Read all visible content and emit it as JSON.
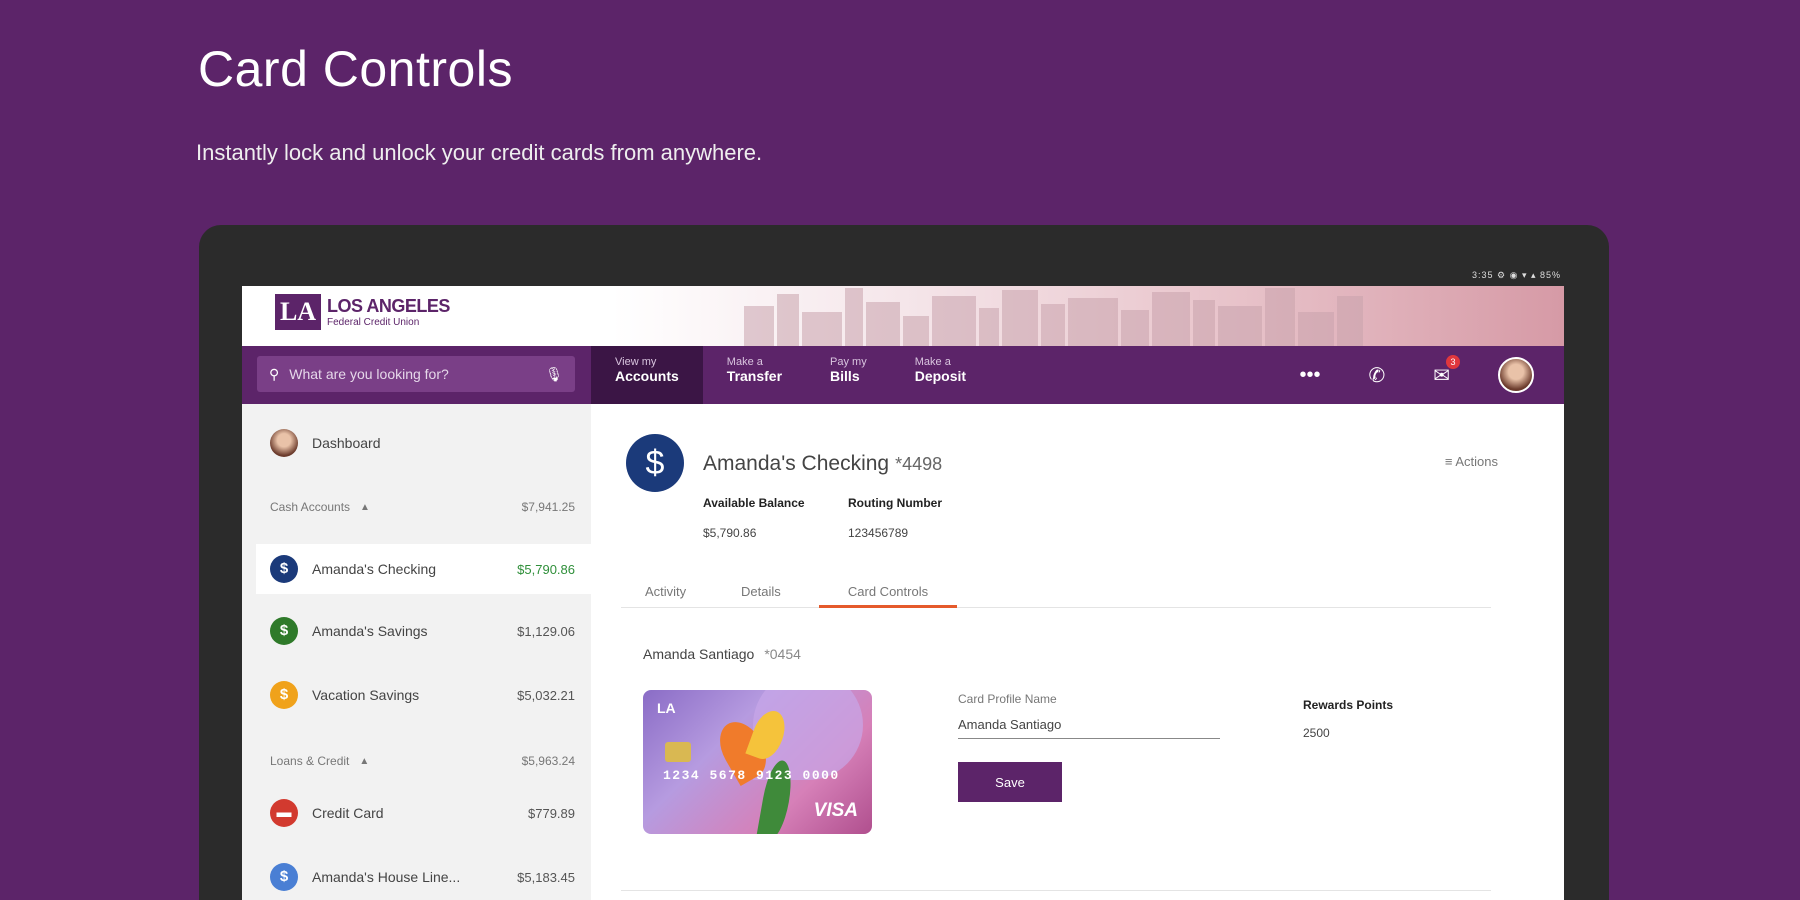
{
  "hero": {
    "title": "Card Controls",
    "subtitle": "Instantly lock and unlock your credit cards from anywhere."
  },
  "device": {
    "status": "3:35 ⚙ ◉ ▾ ▴ 85%"
  },
  "brand": {
    "mark": "LA",
    "line1": "LOS ANGELES",
    "line2": "Federal Credit Union"
  },
  "search": {
    "placeholder": "What are you looking for?"
  },
  "nav": {
    "tabs": [
      {
        "small": "View my",
        "big": "Accounts"
      },
      {
        "small": "Make a",
        "big": "Transfer"
      },
      {
        "small": "Pay my",
        "big": "Bills"
      },
      {
        "small": "Make a",
        "big": "Deposit"
      }
    ],
    "mail_badge": "3"
  },
  "sidebar": {
    "dashboard": "Dashboard",
    "cash_header": {
      "label": "Cash Accounts",
      "value": "$7,941.25"
    },
    "accounts": [
      {
        "name": "Amanda's Checking",
        "value": "$5,790.86",
        "icon": "$",
        "color": "#1b3a7a"
      },
      {
        "name": "Amanda's Savings",
        "value": "$1,129.06",
        "icon": "$",
        "color": "#2f7a2a"
      },
      {
        "name": "Vacation Savings",
        "value": "$5,032.21",
        "icon": "$",
        "color": "#f0a21b"
      }
    ],
    "loans_header": {
      "label": "Loans & Credit",
      "value": "$5,963.24"
    },
    "loans": [
      {
        "name": "Credit Card",
        "value": "$779.89",
        "icon": "▬",
        "color": "#d23a2f"
      },
      {
        "name": "Amanda's House Line...",
        "value": "$5,183.45",
        "icon": "$",
        "color": "#4a7fd4"
      }
    ]
  },
  "account": {
    "name": "Amanda's Checking",
    "number": "*4498",
    "actions": "Actions",
    "available_label": "Available Balance",
    "available_value": "$5,790.86",
    "routing_label": "Routing Number",
    "routing_value": "123456789"
  },
  "tabs": [
    "Activity",
    "Details",
    "Card Controls"
  ],
  "card_controls": {
    "holder": "Amanda Santiago",
    "holder_num": "*0454",
    "card_number": "1234 5678 9123 0000",
    "card_brand": "VISA",
    "profile_label": "Card Profile Name",
    "profile_value": "Amanda Santiago",
    "save_label": "Save",
    "rewards_label": "Rewards Points",
    "rewards_value": "2500"
  },
  "colors": {
    "brand_purple": "#5c2469",
    "tab_underline": "#e55a2b",
    "positive": "#2f8f3a"
  }
}
